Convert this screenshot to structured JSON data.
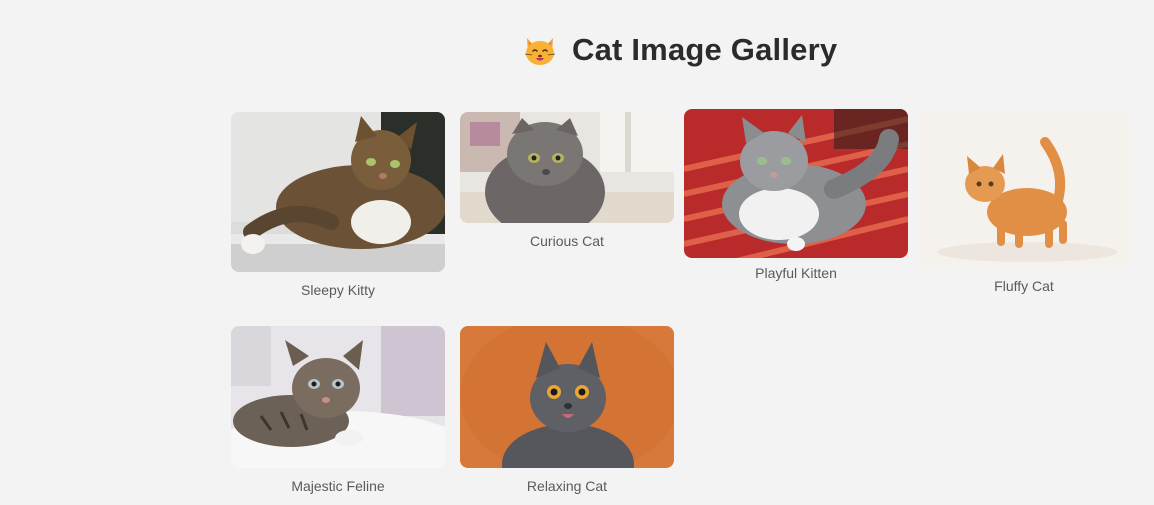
{
  "header": {
    "icon": "cat-face-emoji-icon",
    "title": "Cat Image Gallery"
  },
  "gallery": {
    "items": [
      {
        "caption": "Sleepy Kitty",
        "image": "tabby-longhair-cat-lying-photo"
      },
      {
        "caption": "Curious Cat",
        "image": "grey-scottish-fold-cat-photo"
      },
      {
        "caption": "Playful Kitten",
        "image": "grey-white-cat-on-red-striped-cushion-photo"
      },
      {
        "caption": "Fluffy Cat",
        "image": "ginger-kitten-tail-up-photo"
      },
      {
        "caption": "Majestic Feline",
        "image": "tabby-kitten-on-white-blanket-photo"
      },
      {
        "caption": "Relaxing Cat",
        "image": "grey-british-shorthair-orange-background-photo"
      }
    ]
  }
}
